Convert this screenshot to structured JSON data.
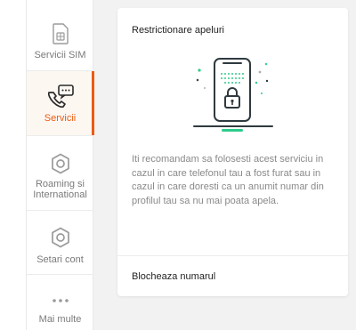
{
  "sidebar": {
    "items": [
      {
        "label": "Servicii SIM",
        "icon": "sim-card-icon",
        "active": false
      },
      {
        "label": "Servicii",
        "icon": "phone-chat-icon",
        "active": true
      },
      {
        "label": "Roaming si International",
        "icon": "hexagon-settings-icon",
        "active": false
      },
      {
        "label": "Setari cont",
        "icon": "hexagon-settings-icon",
        "active": false
      },
      {
        "label": "Mai multe",
        "icon": "more-dots-icon",
        "active": false
      }
    ]
  },
  "card": {
    "title": "Restrictionare apeluri",
    "illustration": "locked-phone-icon",
    "description": "Iti recomandam sa folosesti acest serviciu in cazul in care telefonul tau a fost furat sau in cazul in care doresti ca un anumit numar din profilul tau sa nu mai poata apela.",
    "action_label": "Blocheaza numarul"
  },
  "colors": {
    "accent": "#ec5b12",
    "icon_gray": "#9a9a9a",
    "illustration_dark": "#2f3a3f",
    "illustration_green": "#2ecc8a",
    "background": "#f2f2f2"
  }
}
